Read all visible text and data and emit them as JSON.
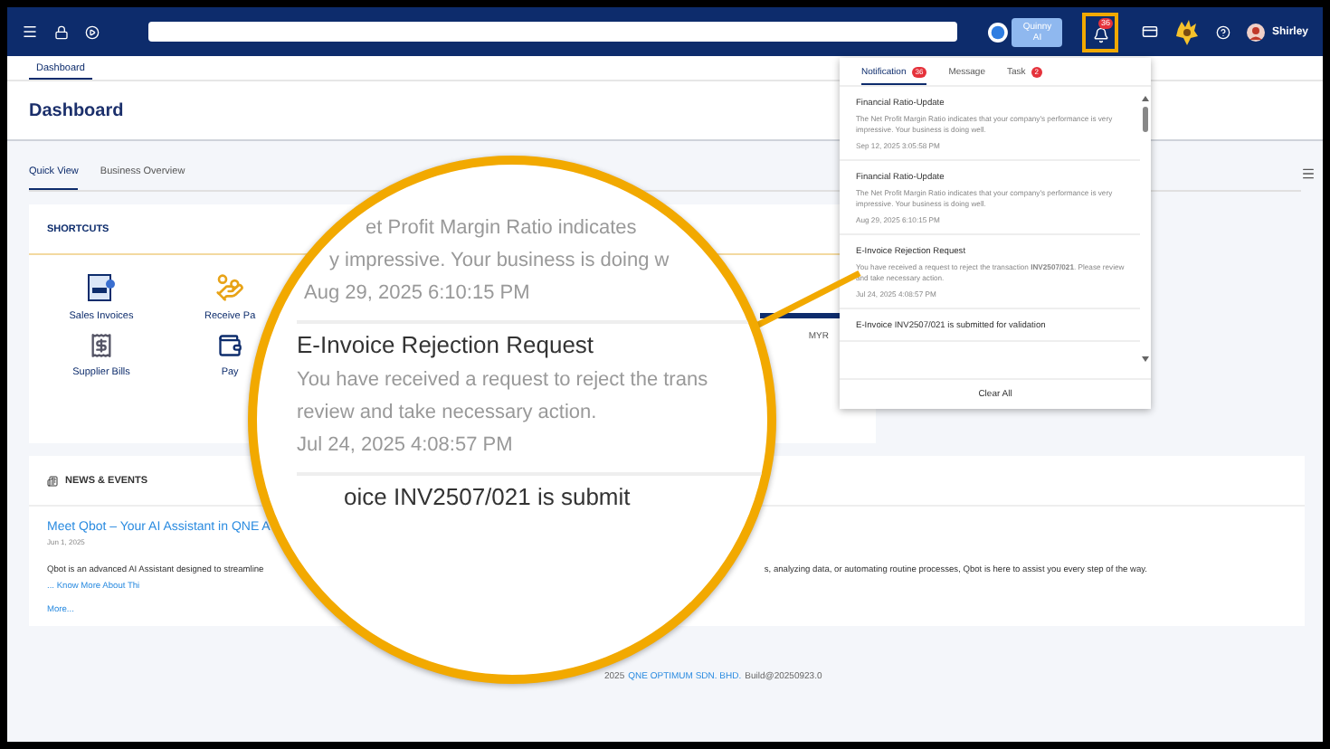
{
  "topbar": {
    "ai_label": "Quinny AI",
    "notification_count": "36",
    "user": "Shirley"
  },
  "breadcrumb_tab": {
    "label": "Dashboard",
    "selected": true
  },
  "page_title": "Dashboard",
  "view_tabs": [
    {
      "label": "Quick View",
      "selected": true
    },
    {
      "label": "Business Overview",
      "selected": false
    }
  ],
  "shortcuts": {
    "title": "SHORTCUTS",
    "items": [
      {
        "kind": "invoice",
        "label": "Sales Invoices"
      },
      {
        "kind": "payment",
        "label": "Receive Pa"
      },
      {
        "kind": "bill",
        "label": "Supplier Bills"
      },
      {
        "kind": "wallet",
        "label": "Pay"
      }
    ],
    "summary_label": "MYR"
  },
  "news": {
    "title": "NEWS & EVENTS",
    "items": [
      {
        "title": "Meet Qbot – Your AI Assistant in QNE A",
        "date": "Jun 1, 2025",
        "body_start": "Qbot is an advanced AI Assistant designed to streamline",
        "body_end": "s, analyzing data, or automating routine processes, Qbot is here to assist you every step of the way.",
        "link": "... Know More About Thi"
      }
    ],
    "more": "More..."
  },
  "footer": {
    "year": "2025",
    "company": "QNE OPTIMUM SDN. BHD.",
    "build": "Build@20250923.0"
  },
  "notifications": {
    "tabs": [
      {
        "label": "Notification",
        "count": "36",
        "selected": true
      },
      {
        "label": "Message",
        "selected": false
      },
      {
        "label": "Task",
        "count": "2",
        "selected": false
      }
    ],
    "items": [
      {
        "title": "Financial Ratio-Update",
        "body": "The Net Profit Margin Ratio indicates that your company's performance is very impressive. Your business is doing well.",
        "time": "Sep 12, 2025 3:05:58 PM"
      },
      {
        "title": "Financial Ratio-Update",
        "body": "The Net Profit Margin Ratio indicates that your company's performance is very impressive. Your business is doing well.",
        "time": "Aug 29, 2025 6:10:15 PM"
      },
      {
        "title": "E-Invoice Rejection Request",
        "body": "You have received a request to reject the transaction **INV2507/021**. Please review and take necessary action.",
        "time": "Jul 24, 2025 4:08:57 PM"
      },
      {
        "title": "E-Invoice INV2507/021 is submitted for validation"
      }
    ],
    "clear": "Clear All"
  },
  "magnifier": {
    "groups": [
      {
        "lines": [
          {
            "kind": "body",
            "text": "et Profit Margin Ratio indicates"
          },
          {
            "kind": "body",
            "text": "y impressive. Your business is doing w"
          },
          {
            "kind": "time",
            "text": "Aug 29, 2025 6:10:15 PM"
          }
        ]
      },
      {
        "lines": [
          {
            "kind": "title",
            "text": "E-Invoice Rejection Request"
          },
          {
            "kind": "body",
            "text": "You have received a request to reject the trans"
          },
          {
            "kind": "body",
            "text": "review and take necessary action."
          },
          {
            "kind": "time",
            "text": "Jul 24, 2025 4:08:57 PM"
          }
        ]
      },
      {
        "lines": [
          {
            "kind": "title",
            "text": "oice INV2507/021 is submit"
          }
        ]
      }
    ]
  }
}
